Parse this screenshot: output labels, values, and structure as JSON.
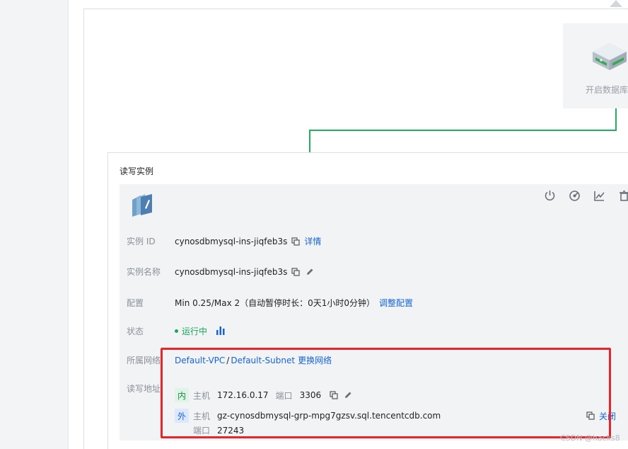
{
  "db_node": {
    "label": "开启数据库"
  },
  "instance_card": {
    "title": "读写实例",
    "rows": {
      "instance_id": {
        "label": "实例 ID",
        "value": "cynosdbmysql-ins-jiqfeb3s",
        "detail_link": "详情"
      },
      "instance_name": {
        "label": "实例名称",
        "value": "cynosdbmysql-ins-jiqfeb3s"
      },
      "config": {
        "label": "配置",
        "value": "Min 0.25/Max 2（自动暂停时长：0天1小时0分钟）",
        "action": "调整配置"
      },
      "status": {
        "label": "状态",
        "value": "运行中"
      },
      "network": {
        "label": "所属网络",
        "vpc": "Default-VPC",
        "separator": "/",
        "subnet": "Default-Subnet",
        "action": "更换网络"
      },
      "address": {
        "label": "读写地址",
        "internal": {
          "tag": "内",
          "host_label": "主机",
          "host": "172.16.0.17",
          "port_label": "端口",
          "port": "3306"
        },
        "external": {
          "tag": "外",
          "host_label": "主机",
          "host": "gz-cynosdbmysql-grp-mpg7gzsv.sql.tencentcdb.com",
          "port_label": "端口",
          "port": "27243",
          "close_action": "关闭"
        }
      }
    }
  },
  "watermark": "CSDN @hacks8",
  "colors": {
    "accent": "#1664d9",
    "running": "#14a85a",
    "highlight": "#e8252a",
    "topology_line": "#20b060"
  }
}
